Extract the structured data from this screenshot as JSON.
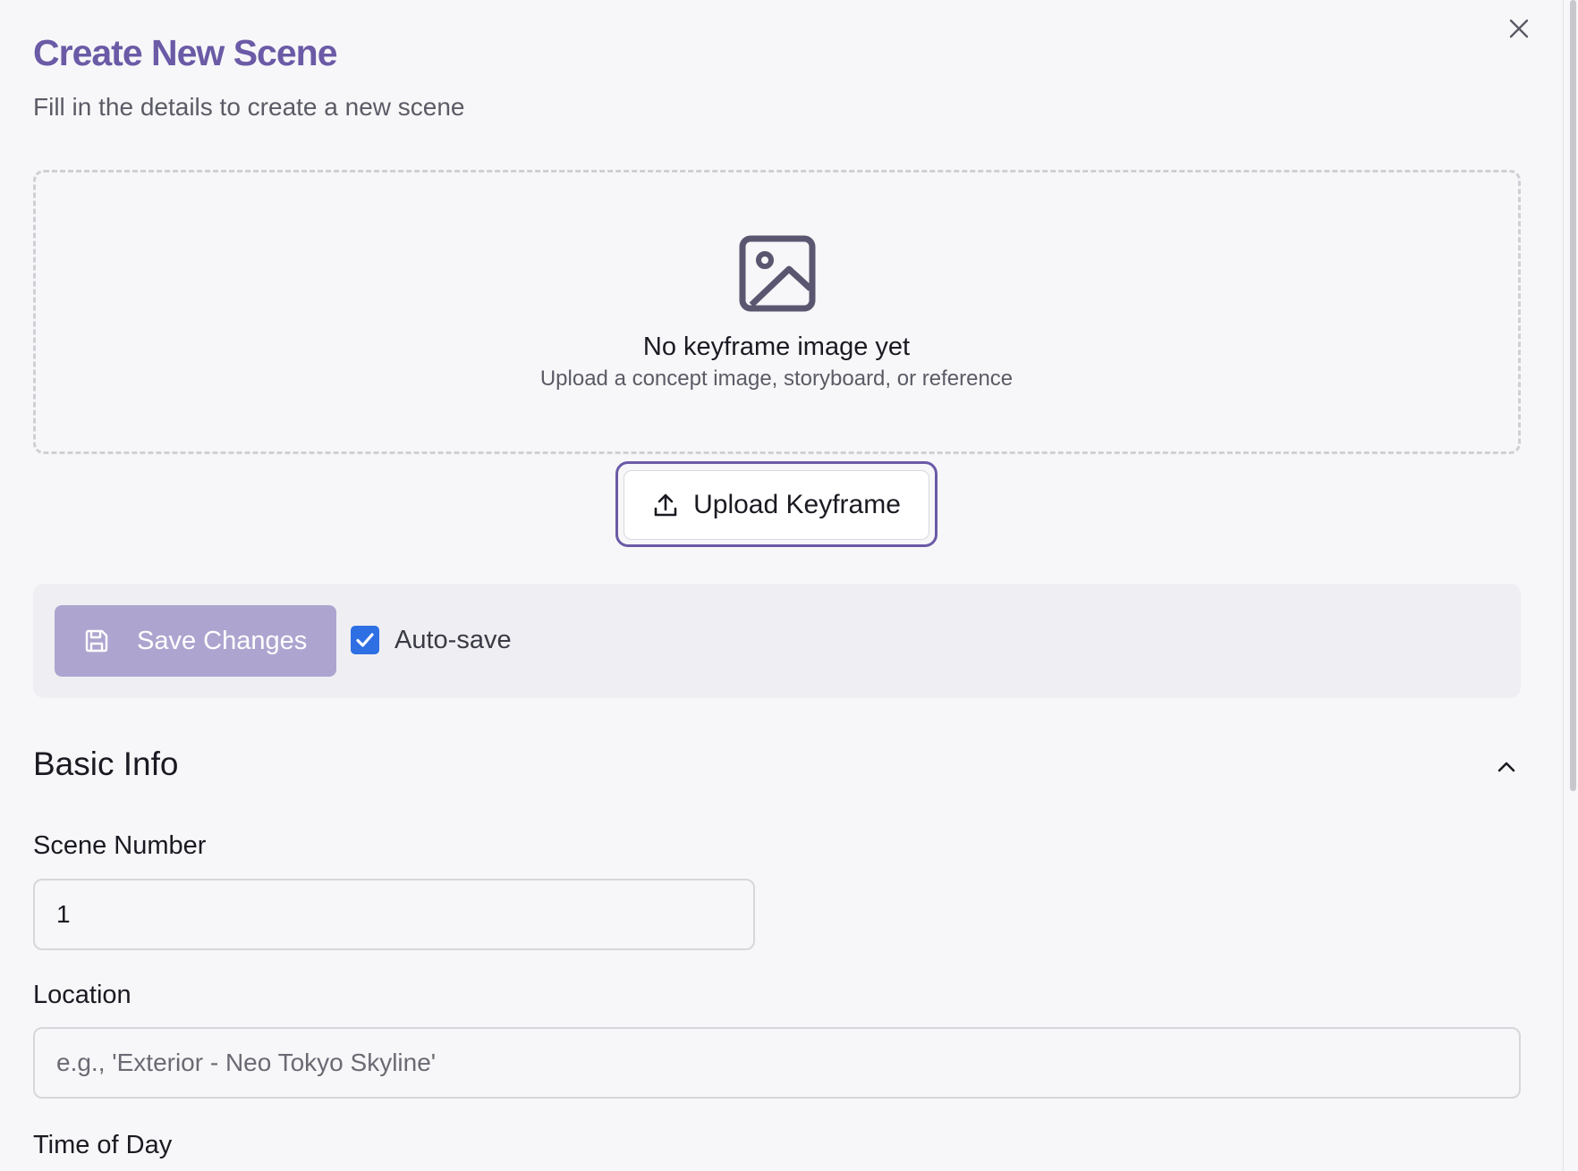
{
  "dialog": {
    "title": "Create New Scene",
    "subtitle": "Fill in the details to create a new scene",
    "close_icon": "close-icon"
  },
  "keyframe": {
    "icon": "image-icon",
    "empty_title": "No keyframe image yet",
    "empty_subtitle": "Upload a concept image, storyboard, or reference",
    "upload_label": "Upload Keyframe",
    "upload_icon": "upload-icon"
  },
  "toolbar": {
    "save_label": "Save Changes",
    "save_icon": "save-icon",
    "autosave_label": "Auto-save",
    "autosave_checked": true
  },
  "basic_info": {
    "title": "Basic Info",
    "collapse_icon": "chevron-up-icon",
    "scene_number_label": "Scene Number",
    "scene_number_value": "1",
    "location_label": "Location",
    "location_placeholder": "e.g., 'Exterior - Neo Tokyo Skyline'",
    "time_of_day_label": "Time of Day"
  },
  "colors": {
    "accent": "#6b5aa6",
    "save_button": "#ada5cf",
    "checkbox": "#2f6fe4"
  }
}
